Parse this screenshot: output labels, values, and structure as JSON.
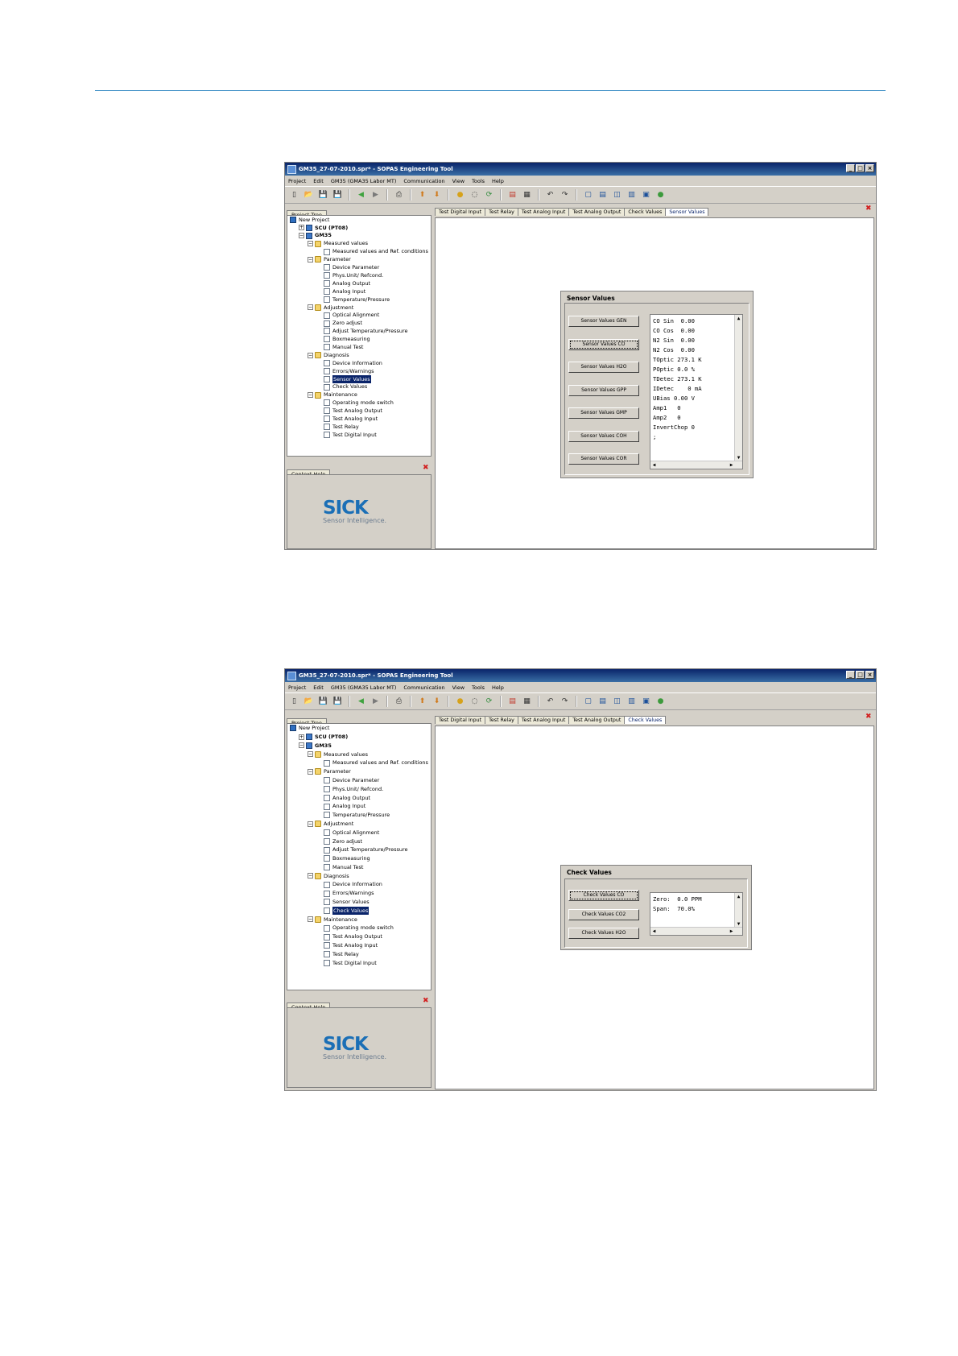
{
  "windows": [
    {
      "title": "GM35_27-07-2010.spr* - SOPAS Engineering Tool",
      "menu": [
        "Project",
        "Edit",
        "GM35 (GMA35 Labor MT)",
        "Communication",
        "View",
        "Tools",
        "Help"
      ],
      "project_tree_tab": "Project Tree",
      "context_help_tab": "Context Help",
      "logo": {
        "word": "SICK",
        "tagline": "Sensor Intelligence."
      },
      "tabs": [
        "Test Digital Input",
        "Test Relay",
        "Test Analog Input",
        "Test Analog Output",
        "Check Values",
        "Sensor Values"
      ],
      "active_tab": "Sensor Values",
      "tree": [
        {
          "label": "New Project",
          "level": 0,
          "icon": "project-icon"
        },
        {
          "label": "SCU (PT08)",
          "level": 1,
          "icon": "device-icon",
          "expander": "+",
          "bold": true
        },
        {
          "label": "GM35",
          "level": 1,
          "icon": "device-icon",
          "expander": "-",
          "bold": true
        },
        {
          "label": "Measured values",
          "level": 2,
          "icon": "folder-icon",
          "expander": "-"
        },
        {
          "label": "Measured values and Ref. conditions",
          "level": 3,
          "icon": "page-icon"
        },
        {
          "label": "Parameter",
          "level": 2,
          "icon": "folder-icon",
          "expander": "-"
        },
        {
          "label": "Device Parameter",
          "level": 3,
          "icon": "page-icon"
        },
        {
          "label": "Phys.Unit/ Refcond.",
          "level": 3,
          "icon": "page-icon"
        },
        {
          "label": "Analog Output",
          "level": 3,
          "icon": "page-icon"
        },
        {
          "label": "Analog Input",
          "level": 3,
          "icon": "page-icon"
        },
        {
          "label": "Temperature/Pressure",
          "level": 3,
          "icon": "page-icon"
        },
        {
          "label": "Adjustment",
          "level": 2,
          "icon": "folder-icon",
          "expander": "-"
        },
        {
          "label": "Optical Alignment",
          "level": 3,
          "icon": "page-icon"
        },
        {
          "label": "Zero adjust",
          "level": 3,
          "icon": "page-icon"
        },
        {
          "label": "Adjust Temperature/Pressure",
          "level": 3,
          "icon": "page-icon"
        },
        {
          "label": "Boxmeasuring",
          "level": 3,
          "icon": "page-icon"
        },
        {
          "label": "Manual Test",
          "level": 3,
          "icon": "page-icon"
        },
        {
          "label": "Diagnosis",
          "level": 2,
          "icon": "folder-icon",
          "expander": "-"
        },
        {
          "label": "Device Information",
          "level": 3,
          "icon": "page-icon"
        },
        {
          "label": "Errors/Warnings",
          "level": 3,
          "icon": "page-icon"
        },
        {
          "label": "Sensor Values",
          "level": 3,
          "icon": "page-icon",
          "selected": true
        },
        {
          "label": "Check Values",
          "level": 3,
          "icon": "page-icon"
        },
        {
          "label": "Maintenance",
          "level": 2,
          "icon": "folder-icon",
          "expander": "-"
        },
        {
          "label": "Operating mode switch",
          "level": 3,
          "icon": "page-icon"
        },
        {
          "label": "Test Analog Output",
          "level": 3,
          "icon": "page-icon"
        },
        {
          "label": "Test Analog Input",
          "level": 3,
          "icon": "page-icon"
        },
        {
          "label": "Test Relay",
          "level": 3,
          "icon": "page-icon"
        },
        {
          "label": "Test Digital Input",
          "level": 3,
          "icon": "page-icon"
        }
      ],
      "dialog": {
        "title": "Sensor Values",
        "buttons": [
          "Sensor Values GEN",
          "Sensor Values  CO",
          "Sensor Values H2O",
          "Sensor Values GPP",
          "Sensor Values GMP",
          "Sensor Values COH",
          "Sensor Values COR"
        ],
        "focused_button": 1,
        "output_lines": [
          "CO Sin  0.00",
          "CO Cos  0.00",
          "N2 Sin  0.00",
          "N2 Cos  0.00",
          "TOptic 273.1 K",
          "POptic 0.0 %",
          "TDetec 273.1 K",
          "IDetec    0 mA",
          "UBias 0.00 V",
          "Amp1   0",
          "Amp2   0",
          "InvertChop 0",
          ";"
        ]
      }
    },
    {
      "title": "GM35_27-07-2010.spr* - SOPAS Engineering Tool",
      "menu": [
        "Project",
        "Edit",
        "GM35 (GMA35 Labor MT)",
        "Communication",
        "View",
        "Tools",
        "Help"
      ],
      "project_tree_tab": "Project Tree",
      "context_help_tab": "Context Help",
      "logo": {
        "word": "SICK",
        "tagline": "Sensor Intelligence."
      },
      "tabs": [
        "Test Digital Input",
        "Test Relay",
        "Test Analog Input",
        "Test Analog Output",
        "Check Values"
      ],
      "active_tab": "Check Values",
      "tree": [
        {
          "label": "New Project",
          "level": 0,
          "icon": "project-icon"
        },
        {
          "label": "SCU (PT08)",
          "level": 1,
          "icon": "device-icon",
          "expander": "+",
          "bold": true
        },
        {
          "label": "GM35",
          "level": 1,
          "icon": "device-icon",
          "expander": "-",
          "bold": true
        },
        {
          "label": "Measured values",
          "level": 2,
          "icon": "folder-icon",
          "expander": "-"
        },
        {
          "label": "Measured values and Ref. conditions",
          "level": 3,
          "icon": "page-icon"
        },
        {
          "label": "Parameter",
          "level": 2,
          "icon": "folder-icon",
          "expander": "-"
        },
        {
          "label": "Device Parameter",
          "level": 3,
          "icon": "page-icon"
        },
        {
          "label": "Phys.Unit/ Refcond.",
          "level": 3,
          "icon": "page-icon"
        },
        {
          "label": "Analog Output",
          "level": 3,
          "icon": "page-icon"
        },
        {
          "label": "Analog Input",
          "level": 3,
          "icon": "page-icon"
        },
        {
          "label": "Temperature/Pressure",
          "level": 3,
          "icon": "page-icon"
        },
        {
          "label": "Adjustment",
          "level": 2,
          "icon": "folder-icon",
          "expander": "-"
        },
        {
          "label": "Optical Alignment",
          "level": 3,
          "icon": "page-icon"
        },
        {
          "label": "Zero adjust",
          "level": 3,
          "icon": "page-icon"
        },
        {
          "label": "Adjust Temperature/Pressure",
          "level": 3,
          "icon": "page-icon"
        },
        {
          "label": "Boxmeasuring",
          "level": 3,
          "icon": "page-icon"
        },
        {
          "label": "Manual Test",
          "level": 3,
          "icon": "page-icon"
        },
        {
          "label": "Diagnosis",
          "level": 2,
          "icon": "folder-icon",
          "expander": "-"
        },
        {
          "label": "Device Information",
          "level": 3,
          "icon": "page-icon"
        },
        {
          "label": "Errors/Warnings",
          "level": 3,
          "icon": "page-icon"
        },
        {
          "label": "Sensor Values",
          "level": 3,
          "icon": "page-icon"
        },
        {
          "label": "Check Values",
          "level": 3,
          "icon": "page-icon",
          "selected": true
        },
        {
          "label": "Maintenance",
          "level": 2,
          "icon": "folder-icon",
          "expander": "-"
        },
        {
          "label": "Operating mode switch",
          "level": 3,
          "icon": "page-icon"
        },
        {
          "label": "Test Analog Output",
          "level": 3,
          "icon": "page-icon"
        },
        {
          "label": "Test Analog Input",
          "level": 3,
          "icon": "page-icon"
        },
        {
          "label": "Test Relay",
          "level": 3,
          "icon": "page-icon"
        },
        {
          "label": "Test Digital Input",
          "level": 3,
          "icon": "page-icon"
        }
      ],
      "dialog": {
        "title": "Check Values",
        "buttons": [
          "Check Values  CO",
          "Check Values CO2",
          "Check Values H2O"
        ],
        "focused_button": 0,
        "output_lines": [
          "Zero:  0.0 PPM",
          "Span:  70.0%"
        ]
      }
    }
  ],
  "toolbar_icons": [
    "new-icon",
    "open-icon",
    "save-icon",
    "save-all-icon",
    "back-icon",
    "forward-icon",
    "print-icon",
    "upload-icon",
    "download-icon",
    "connect-icon",
    "disconnect-icon",
    "refresh-icon",
    "pdf-icon",
    "report-icon",
    "undo-icon",
    "redo-icon",
    "layout1-icon",
    "layout2-icon",
    "layout3-icon",
    "layout4-icon",
    "layout5-icon",
    "help-icon"
  ],
  "colors": {
    "rule": "#3d8fc6",
    "titlebar": "#0a246a",
    "logo": "#1b6fb6",
    "close": "#d21f1f"
  }
}
